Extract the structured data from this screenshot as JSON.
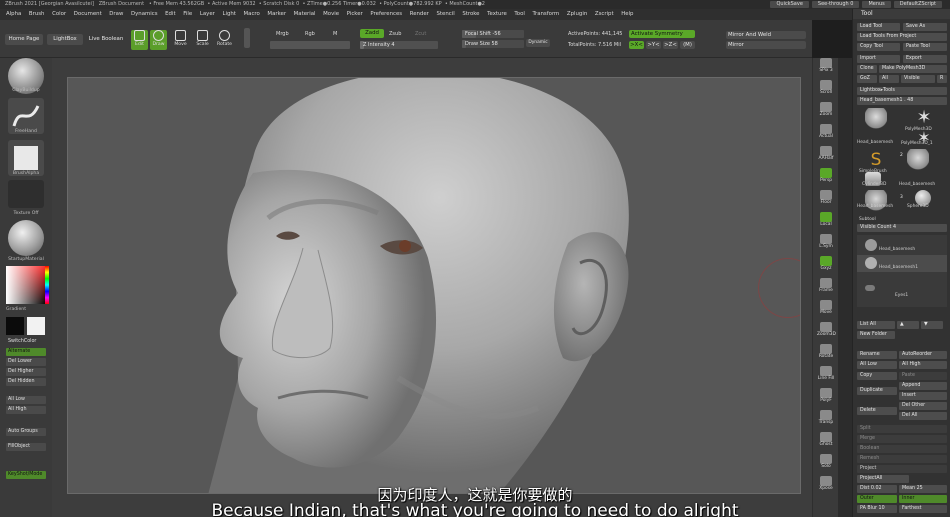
{
  "window": {
    "title": "ZBrush 2021 [Georgian Avasilcutei]",
    "document": "ZBrush Document",
    "stats": [
      "• Free Mem 43.562GB",
      "• Active Mem 9032",
      "• Scratch Disk 0",
      "• ZTime●0.256 Timer●0.032",
      "• PolyCount●782.992 KP",
      "• MeshCount●2"
    ],
    "right_buttons": [
      "QuickSave",
      "See-through 0",
      "Menus",
      "DefaultZScript"
    ]
  },
  "menubar": [
    "Alpha",
    "Brush",
    "Color",
    "Document",
    "Draw",
    "Dynamics",
    "Edit",
    "File",
    "Layer",
    "Light",
    "Macro",
    "Marker",
    "Material",
    "Movie",
    "Picker",
    "Preferences",
    "Render",
    "Stencil",
    "Stroke",
    "Texture",
    "Tool",
    "Transform",
    "Zplugin",
    "Zscript",
    "Help"
  ],
  "topshelf": {
    "home_page": "Home Page",
    "lightbox": "LightBox",
    "live_boolean": "Live Boolean",
    "tools": [
      "Edit",
      "Draw",
      "Move",
      "Scale",
      "Rotate"
    ],
    "mrgb": "Mrgb",
    "rgb": "Rgb",
    "m": "M",
    "zadd": "Zadd",
    "zsub": "Zsub",
    "zcut": "Zcut",
    "z_intensity": "Z Intensity 4",
    "focal_shift": "Focal Shift -56",
    "draw_size": "Draw Size 58",
    "dynamic": "Dynamic",
    "active_points": "ActivePoints: 441,145",
    "total_points": "TotalPoints: 7.516 Mil",
    "activate_symmetry": "Activate Symmetry",
    "axes": [
      ">X<",
      ">Y<",
      ">Z<",
      "(M)"
    ],
    "mirror_and_weld": "Mirror And Weld",
    "mirror": "Mirror"
  },
  "leftshelf": {
    "brush": "ClayBuildup",
    "stroke": "FreeHand",
    "alpha": "BrushAlpha",
    "texture": "Texture Off",
    "material": "StartupMaterial",
    "gradient": "Gradient",
    "switch_color": "SwitchColor",
    "alternate": "Alternate",
    "buttons": [
      "Del Lower",
      "Del Higher",
      "Del Hidden"
    ],
    "buttons2": [
      "All Low",
      "All High"
    ],
    "auto_groups": "Auto Groups",
    "fill_object": "FillObject",
    "keyshot_mode": "KeyShot/Mode"
  },
  "rightshelf": [
    "SPix 3",
    "Scroll",
    "Zoom",
    "Actual",
    "AAHalf",
    "Persp",
    "Floor",
    "Local",
    "L.Sym",
    "Gxyz",
    "Frame",
    "Move",
    "Zoom3D",
    "Rotate",
    "Line Fill",
    "PolyF",
    "Transp",
    "Ghost",
    "Solo",
    "Xpose"
  ],
  "toolpanel": {
    "title": "Tool",
    "load_tool": "Load Tool",
    "save_as": "Save As",
    "load_from_project": "Load Tools From Project",
    "copy_tool": "Copy Tool",
    "paste_tool": "Paste Tool",
    "import": "Import",
    "export": "Export",
    "clone": "Clone",
    "make_polymesh": "Make PolyMesh3D",
    "goz": "GoZ",
    "all": "All",
    "visible": "Visible",
    "r": "R",
    "lightbox_tools": "Lightbox▸Tools",
    "current": "Head_basemesh1 . 48",
    "thumbs": [
      "Head_basemesh",
      "PolyMesh3D",
      "SimpleBrush",
      "PolyMesh3D_1",
      "Cylinder3D",
      "Head_basemesh",
      "Head_basemesh",
      "Sphere3D"
    ],
    "thumb_counts": [
      "2",
      "3"
    ],
    "subtool": "Subtool",
    "visible_count": "Visible Count 4",
    "subtools": [
      "Head_basemesh",
      "Head_basemesh1",
      "Eyes1"
    ],
    "list_all": "List All",
    "new_folder": "New Folder",
    "rename": "Rename",
    "auto_reorder": "AutoReorder",
    "all_low": "All Low",
    "all_high": "All High",
    "copy": "Copy",
    "paste": "Paste",
    "duplicate": "Duplicate",
    "append": "Append",
    "insert": "Insert",
    "delete": "Delete",
    "del_other": "Del Other",
    "del_all": "Del All",
    "split": "Split",
    "merge": "Merge",
    "boolean": "Boolean",
    "remesh": "Remesh",
    "project": "Project",
    "project_all": "ProjectAll",
    "dist": "Dist 0.02",
    "mean": "Mean 25",
    "pa_blur": "PA Blur 10",
    "farthest": "Farthest",
    "outer": "Outer",
    "inner": "Inner"
  },
  "subtitles": {
    "cn": "因为印度人，这就是你要做的",
    "en": "Because Indian, that's what you're going to need to do alright"
  },
  "watermark": "www.52cgzy.com"
}
